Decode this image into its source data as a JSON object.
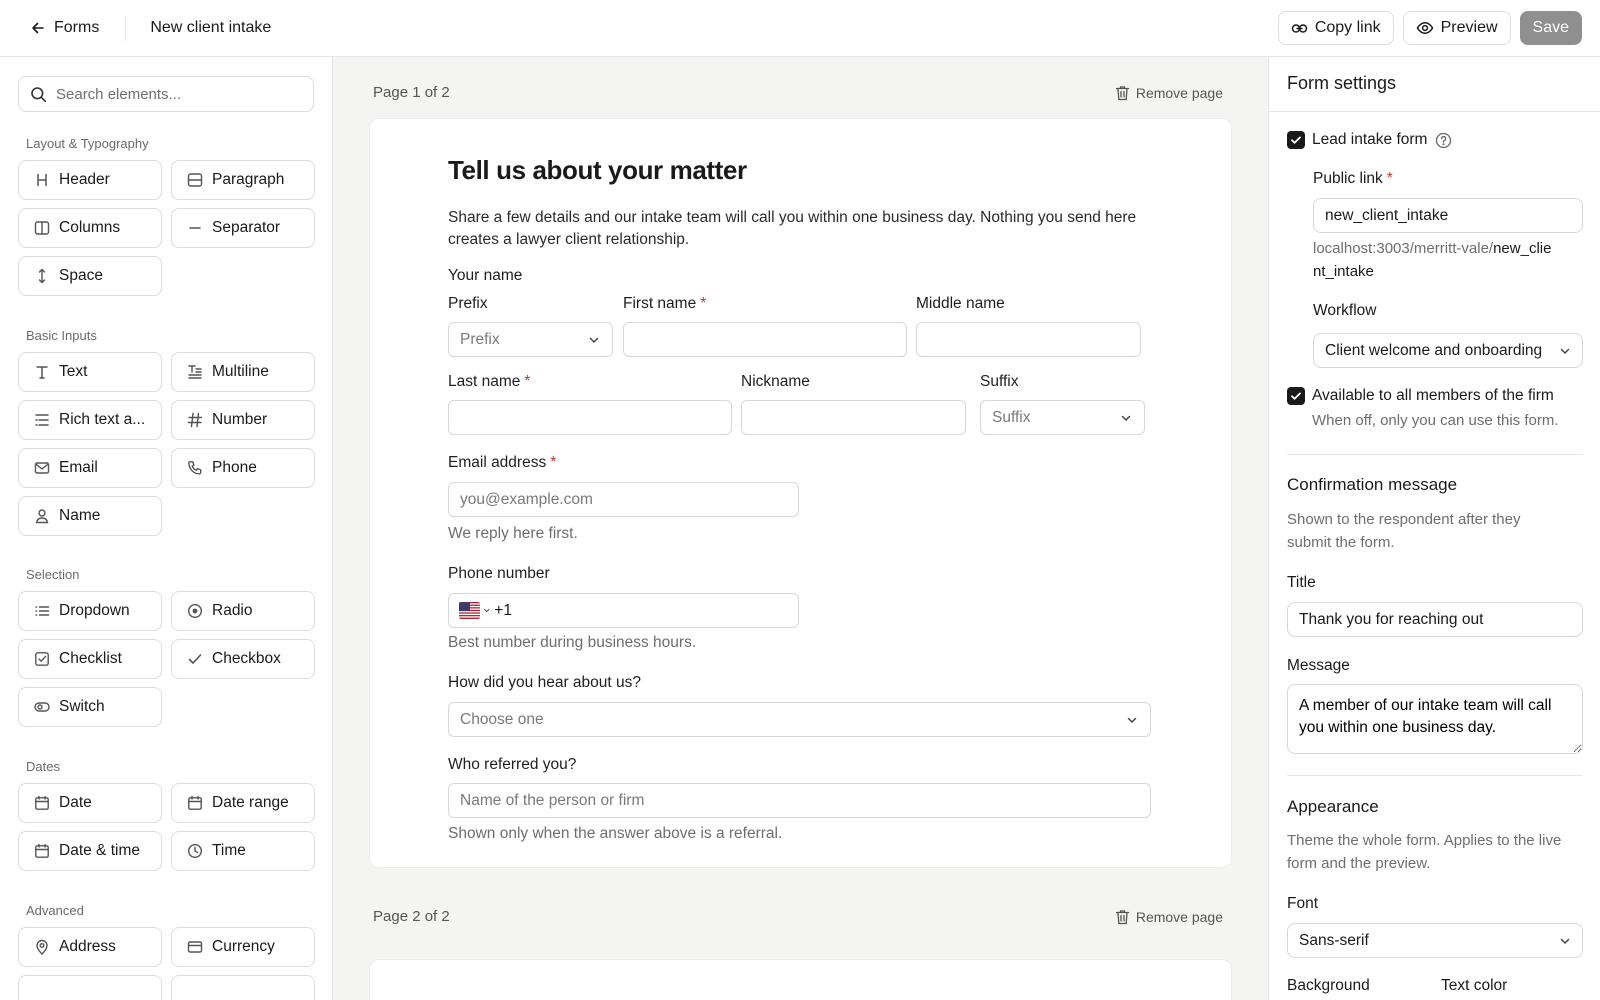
{
  "topbar": {
    "back_label": "Forms",
    "title": "New client intake",
    "copy_link": "Copy link",
    "preview": "Preview",
    "save": "Save"
  },
  "palette": {
    "search_placeholder": "Search elements...",
    "groups": {
      "layout": "Layout & Typography",
      "basic": "Basic Inputs",
      "selection": "Selection",
      "dates": "Dates",
      "advanced": "Advanced"
    },
    "items": {
      "header": "Header",
      "paragraph": "Paragraph",
      "columns": "Columns",
      "separator": "Separator",
      "space": "Space",
      "text": "Text",
      "multiline": "Multiline",
      "rich_text": "Rich text a...",
      "number": "Number",
      "email": "Email",
      "phone": "Phone",
      "name": "Name",
      "dropdown": "Dropdown",
      "radio": "Radio",
      "checklist": "Checklist",
      "checkbox": "Checkbox",
      "switch": "Switch",
      "date": "Date",
      "date_range": "Date range",
      "date_time": "Date & time",
      "time": "Time",
      "address": "Address",
      "currency": "Currency"
    }
  },
  "canvas": {
    "page1_label": "Page 1 of 2",
    "page2_label": "Page 2 of 2",
    "remove_page": "Remove page",
    "form": {
      "title": "Tell us about your matter",
      "description": "Share a few details and our intake team will call you within one business day. Nothing you send here creates a lawyer client relationship.",
      "your_name": "Your name",
      "prefix_label": "Prefix",
      "prefix_placeholder": "Prefix",
      "first_name_label": "First name",
      "middle_name_label": "Middle name",
      "last_name_label": "Last name",
      "nickname_label": "Nickname",
      "suffix_label": "Suffix",
      "suffix_placeholder": "Suffix",
      "email_label": "Email address",
      "email_placeholder": "you@example.com",
      "email_help": "We reply here first.",
      "phone_label": "Phone number",
      "phone_code": "+1",
      "phone_help": "Best number during business hours.",
      "hear_label": "How did you hear about us?",
      "hear_placeholder": "Choose one",
      "referred_label": "Who referred you?",
      "referred_placeholder": "Name of the person or firm",
      "referred_help": "Shown only when the answer above is a referral.",
      "required_mark": "*"
    }
  },
  "settings": {
    "title": "Form settings",
    "lead_intake_label": "Lead intake form",
    "lead_intake_checked": true,
    "public_link_label": "Public link",
    "public_link_value": "new_client_intake",
    "url_prefix": "localhost:3003/merritt-vale/",
    "url_slug_line1": "new_clie",
    "url_slug_line2": "nt_intake",
    "workflow_label": "Workflow",
    "workflow_value": "Client welcome and onboarding",
    "available_label": "Available to all members of the firm",
    "available_checked": true,
    "available_help": "When off, only you can use this form.",
    "confirmation_title": "Confirmation message",
    "confirmation_help_line1": "Shown to the respondent after they",
    "confirmation_help_line2": "submit the form.",
    "title_label": "Title",
    "title_value": "Thank you for reaching out",
    "message_label": "Message",
    "message_value": "A member of our intake team will call you within one business day.",
    "appearance_title": "Appearance",
    "appearance_help_line1": "Theme the whole form. Applies to the live",
    "appearance_help_line2": "form and the preview.",
    "font_label": "Font",
    "font_value": "Sans-serif",
    "background_label": "Background",
    "text_color_label": "Text color"
  }
}
